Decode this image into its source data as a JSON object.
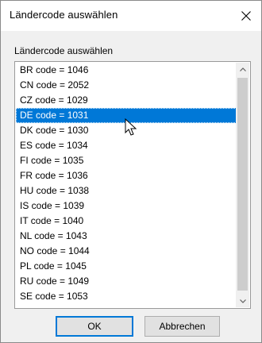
{
  "window": {
    "title": "Ländercode auswählen",
    "close_icon": "close-icon"
  },
  "group_label": "Ländercode auswählen",
  "list": {
    "items": [
      "BR code = 1046",
      "CN code = 2052",
      "CZ code = 1029",
      "DE code = 1031",
      "DK code = 1030",
      "ES code = 1034",
      "FI code = 1035",
      "FR code = 1036",
      "HU code = 1038",
      "IS code = 1039",
      "IT code = 1040",
      "NL code = 1043",
      "NO code = 1044",
      "PL code = 1045",
      "RU code = 1049",
      "SE code = 1053"
    ],
    "selected": "DE code = 1031"
  },
  "buttons": {
    "ok": "OK",
    "cancel": "Abbrechen"
  },
  "colors": {
    "selection": "#0078d7",
    "dialog_bg": "#f0f0f0"
  }
}
